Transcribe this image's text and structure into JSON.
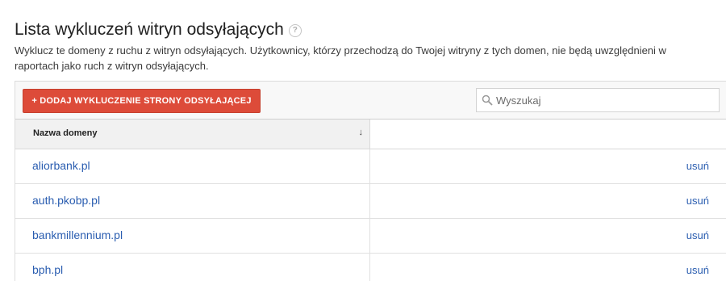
{
  "header": {
    "title": "Lista wykluczeń witryn odsyłających",
    "help_glyph": "?",
    "description": "Wyklucz te domeny z ruchu z witryn odsyłających. Użytkownicy, którzy przechodzą do Twojej witryny z tych domen, nie będą uwzględnieni w raportach jako ruch z witryn odsyłających."
  },
  "toolbar": {
    "add_button_label": "+ DODAJ WYKLUCZENIE STRONY ODSYŁAJĄCEJ",
    "search_placeholder": "Wyszukaj",
    "add_button_color": "#dd4b39"
  },
  "table": {
    "column_domain": "Nazwa domeny",
    "sort_glyph": "↓",
    "rows": [
      {
        "domain": "aliorbank.pl",
        "action": "usuń"
      },
      {
        "domain": "auth.pkobp.pl",
        "action": "usuń"
      },
      {
        "domain": "bankmillennium.pl",
        "action": "usuń"
      },
      {
        "domain": "bph.pl",
        "action": "usuń"
      }
    ]
  },
  "colors": {
    "link": "#2a5db0",
    "header_bg": "#f1f1f1"
  }
}
